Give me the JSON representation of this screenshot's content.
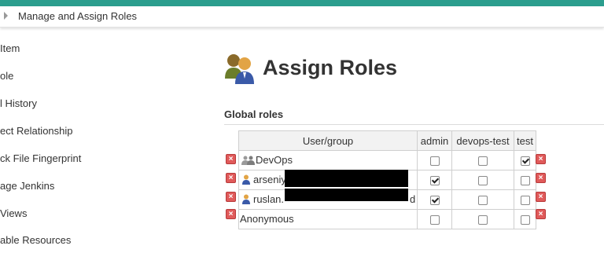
{
  "breadcrumb": {
    "label": "Manage and Assign Roles"
  },
  "sidebar": {
    "items": [
      {
        "label": "Item"
      },
      {
        "label": "ole"
      },
      {
        "label": "l History"
      },
      {
        "label": "ect Relationship"
      },
      {
        "label": "ck File Fingerprint"
      },
      {
        "label": "age Jenkins"
      },
      {
        "label": "Views"
      },
      {
        "label": "able Resources"
      }
    ]
  },
  "page": {
    "title": "Assign Roles"
  },
  "global_roles": {
    "heading": "Global roles",
    "columns": [
      "User/group",
      "admin",
      "devops-test",
      "test"
    ],
    "rows": [
      {
        "name": "DevOps",
        "icon": "group-icon",
        "admin": false,
        "devops_test": false,
        "test": true
      },
      {
        "name": "arseniy",
        "icon": "user-icon",
        "admin": true,
        "devops_test": false,
        "test": false
      },
      {
        "name": "ruslan.",
        "suffix": "d",
        "icon": "user-icon",
        "admin": true,
        "devops_test": false,
        "test": false
      },
      {
        "name": "Anonymous",
        "icon": "",
        "admin": false,
        "devops_test": false,
        "test": false
      }
    ]
  },
  "colors": {
    "accent": "#2c9e8e",
    "delete": "#e05a5a"
  }
}
